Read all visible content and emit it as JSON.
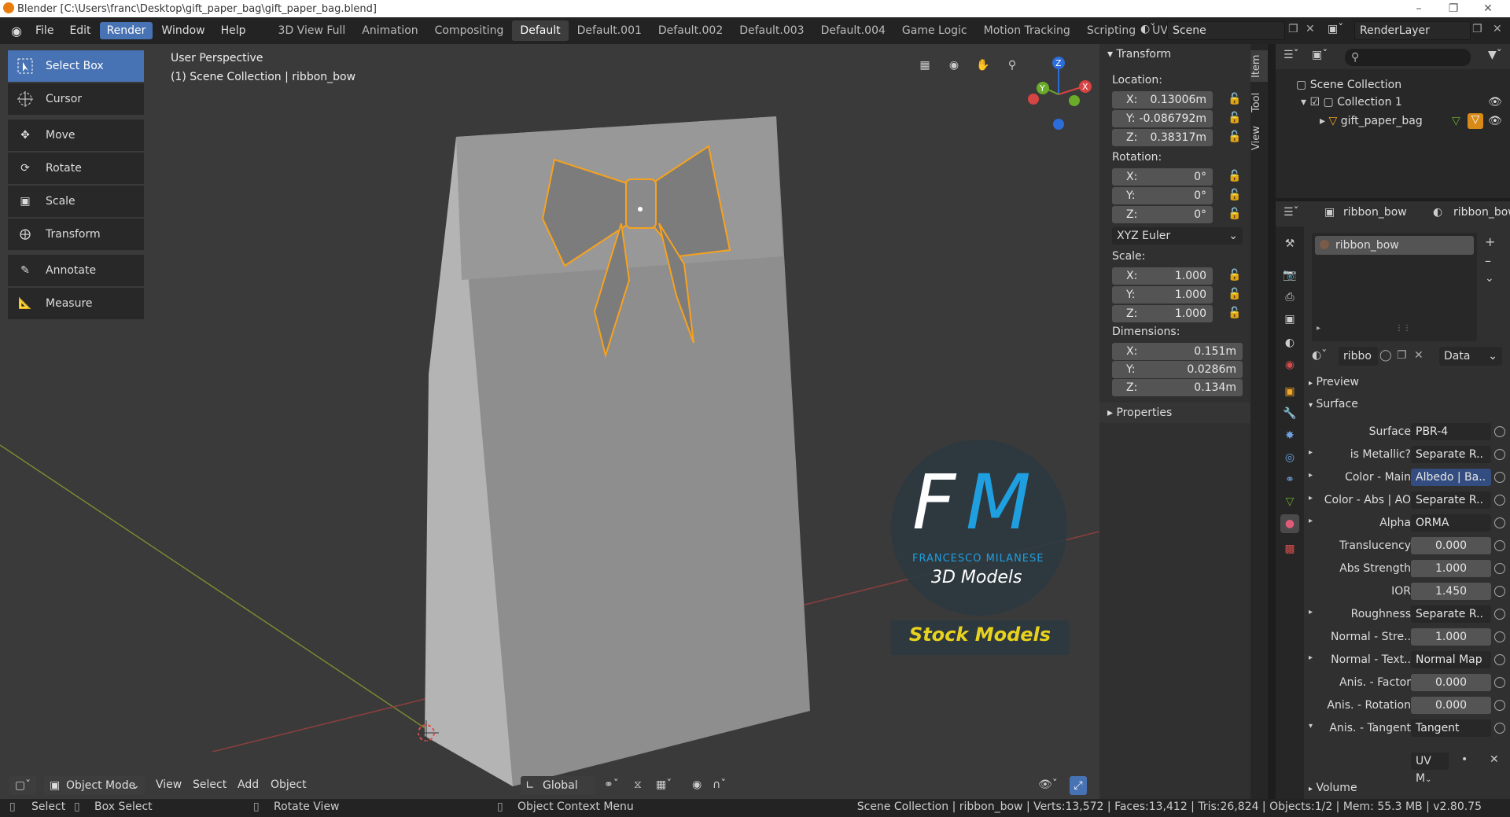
{
  "window": {
    "title": "Blender [C:\\Users\\franc\\Desktop\\gift_paper_bag\\gift_paper_bag.blend]"
  },
  "menus": [
    "File",
    "Edit",
    "Render",
    "Window",
    "Help"
  ],
  "workspaces": [
    "3D View Full",
    "Animation",
    "Compositing",
    "Default",
    "Default.001",
    "Default.002",
    "Default.003",
    "Default.004",
    "Game Logic",
    "Motion Tracking",
    "Scripting",
    "UV Editing"
  ],
  "scene": {
    "name": "Scene",
    "render_layer": "RenderLayer"
  },
  "viewport": {
    "perspective": "User Perspective",
    "collection": "(1) Scene Collection | ribbon_bow",
    "tools": [
      "Select Box",
      "Cursor",
      "Move",
      "Rotate",
      "Scale",
      "Transform",
      "Annotate",
      "Measure"
    ],
    "watermark": {
      "initials_f": "F",
      "initials_m": "M",
      "name": "FRANCESCO MILANESE",
      "sub": "3D Models",
      "banner": "Stock Models"
    },
    "gizmo": {
      "x": "X",
      "y": "Y",
      "z": "Z"
    },
    "header": {
      "mode": "Object Mode",
      "view": "View",
      "select": "Select",
      "add": "Add",
      "object": "Object",
      "orientation": "Global"
    }
  },
  "npanel": {
    "section": "Transform",
    "location_label": "Location:",
    "location": {
      "x": "0.13006m",
      "y": "-0.086792m",
      "z": "0.38317m"
    },
    "rotation_label": "Rotation:",
    "rotation": {
      "x": "0°",
      "y": "0°",
      "z": "0°"
    },
    "rotation_mode": "XYZ Euler",
    "scale_label": "Scale:",
    "scale": {
      "x": "1.000",
      "y": "1.000",
      "z": "1.000"
    },
    "dimensions_label": "Dimensions:",
    "dimensions": {
      "x": "0.151m",
      "y": "0.0286m",
      "z": "0.134m"
    },
    "properties": "Properties",
    "axis": {
      "x": "X:",
      "y": "Y:",
      "z": "Z:"
    },
    "tabs": [
      "Item",
      "Tool",
      "View"
    ]
  },
  "outliner": {
    "root": "Scene Collection",
    "collection": "Collection 1",
    "object": "gift_paper_bag"
  },
  "properties": {
    "object": "ribbon_bow",
    "material": "ribbon_bow",
    "slot": "ribbon_bow",
    "mat_field": "ribbo",
    "link": "Data",
    "preview": "Preview",
    "surface_section": "Surface",
    "volume": "Volume",
    "rows": [
      {
        "label": "Surface",
        "value": "PBR-4",
        "kind": "link",
        "arrow": false
      },
      {
        "label": "is Metallic?",
        "value": "Separate R..",
        "kind": "link",
        "arrow": true
      },
      {
        "label": "Color - Main",
        "value": "Albedo | Ba..",
        "kind": "blue",
        "arrow": true
      },
      {
        "label": "Color - Abs | AO",
        "value": "Separate R..",
        "kind": "link",
        "arrow": true
      },
      {
        "label": "Alpha",
        "value": "ORMA",
        "kind": "link",
        "arrow": true
      },
      {
        "label": "Translucency",
        "value": "0.000",
        "kind": "num",
        "arrow": false
      },
      {
        "label": "Abs Strength",
        "value": "1.000",
        "kind": "num",
        "arrow": false
      },
      {
        "label": "IOR",
        "value": "1.450",
        "kind": "num",
        "arrow": false
      },
      {
        "label": "Roughness",
        "value": "Separate R..",
        "kind": "link",
        "arrow": true
      },
      {
        "label": "Normal - Stre..",
        "value": "1.000",
        "kind": "num",
        "arrow": false
      },
      {
        "label": "Normal - Text..",
        "value": "Normal Map",
        "kind": "link",
        "arrow": true
      },
      {
        "label": "Anis. - Factor",
        "value": "0.000",
        "kind": "num",
        "arrow": false
      },
      {
        "label": "Anis. - Rotation",
        "value": "0.000",
        "kind": "num",
        "arrow": false
      },
      {
        "label": "Anis. - Tangent",
        "value": "Tangent",
        "kind": "link",
        "arrow": true
      }
    ],
    "uvmap": "UV M"
  },
  "statusbar": {
    "select": "Select",
    "box_select": "Box Select",
    "rotate_view": "Rotate View",
    "context_menu": "Object Context Menu",
    "stats": "Scene Collection | ribbon_bow | Verts:13,572 | Faces:13,412 | Tris:26,824 | Objects:1/2 | Mem: 55.3 MB | v2.80.75"
  },
  "colors": {
    "accent": "#4772b3",
    "selection": "#f5a623",
    "background": "#3a3a3a"
  }
}
